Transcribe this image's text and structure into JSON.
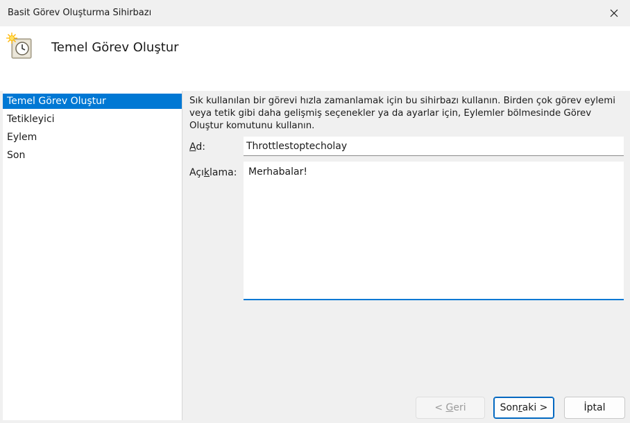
{
  "window": {
    "title": "Basit Görev Oluşturma Sihirbazı"
  },
  "header": {
    "heading": "Temel Görev Oluştur"
  },
  "sidebar": {
    "items": [
      {
        "label": "Temel Görev Oluştur",
        "active": true
      },
      {
        "label": "Tetikleyici",
        "active": false
      },
      {
        "label": "Eylem",
        "active": false
      },
      {
        "label": "Son",
        "active": false
      }
    ]
  },
  "main": {
    "description": "Sık kullanılan bir görevi hızla zamanlamak için bu sihirbazı kullanın. Birden çok görev eylemi veya tetik gibi daha gelişmiş seçenekler ya da ayarlar için, Eylemler bölmesinde Görev Oluştur komutunu kullanın.",
    "name_label_accel": "A",
    "name_label_rest": "d:",
    "name_value": "Throttlestoptecholay",
    "desc_label_pre": "Açı",
    "desc_label_accel": "k",
    "desc_label_post": "lama:",
    "desc_value": "Merhabalar!"
  },
  "buttons": {
    "back_pre": "< ",
    "back_accel": "G",
    "back_post": "eri",
    "next_pre": "Son",
    "next_accel": "r",
    "next_post": "aki >",
    "cancel": "İptal"
  },
  "colors": {
    "accent": "#0078d4",
    "window_bg": "#f0f0f0"
  }
}
